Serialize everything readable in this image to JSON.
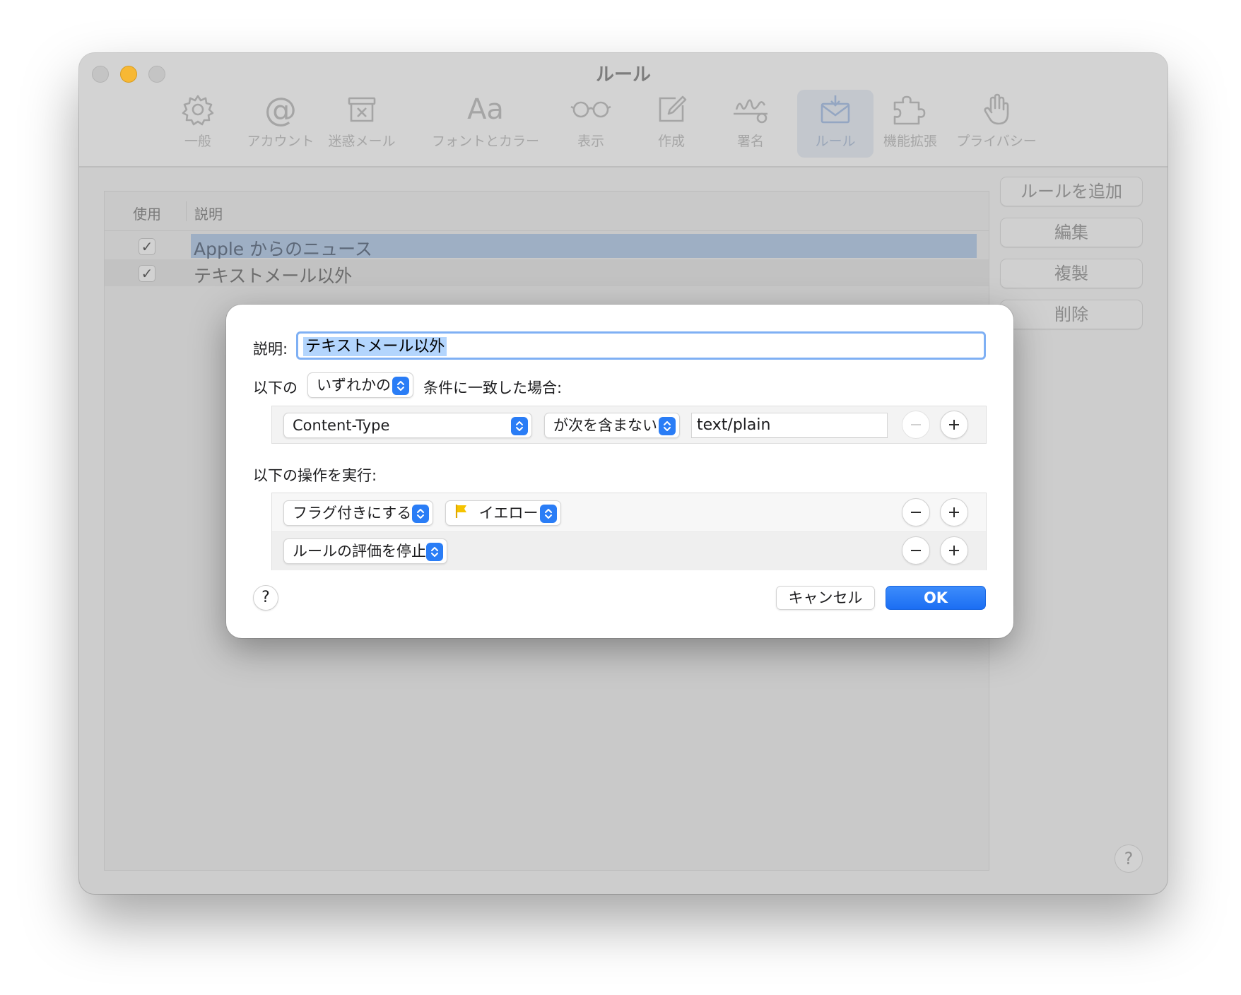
{
  "window": {
    "title": "ルール"
  },
  "toolbar": {
    "tabs": [
      {
        "label": "一般",
        "icon": "gear-icon"
      },
      {
        "label": "アカウント",
        "icon": "at-sign-icon"
      },
      {
        "label": "迷惑メール",
        "icon": "junk-tray-icon"
      },
      {
        "label": "フォントとカラー",
        "icon": "font-icon"
      },
      {
        "label": "表示",
        "icon": "glasses-icon"
      },
      {
        "label": "作成",
        "icon": "compose-icon"
      },
      {
        "label": "署名",
        "icon": "signature-icon"
      },
      {
        "label": "ルール",
        "icon": "rules-envelope-icon"
      },
      {
        "label": "機能拡張",
        "icon": "puzzle-icon"
      },
      {
        "label": "プライバシー",
        "icon": "hand-icon"
      }
    ],
    "active": "ルール",
    "glyphs": {
      "at": "@",
      "font": "Aa"
    }
  },
  "rules_list": {
    "header": {
      "use": "使用",
      "description": "説明"
    },
    "rows": [
      {
        "enabled": true,
        "check": "✓",
        "description": "Apple からのニュース",
        "selected": true
      },
      {
        "enabled": true,
        "check": "✓",
        "description": "テキストメール以外",
        "selected": false
      }
    ]
  },
  "side_buttons": {
    "add_rule": "ルールを追加",
    "edit": "編集",
    "duplicate": "複製",
    "delete": "削除"
  },
  "window_help": "?",
  "dialog": {
    "description_label": "説明:",
    "description_value": "テキストメール以外",
    "condition_prefix": "以下の",
    "match_mode": "いずれかの",
    "condition_suffix": "条件に一致した場合:",
    "condition": {
      "field": "Content-Type",
      "operator": "が次を含まない",
      "value": "text/plain",
      "remove": "−",
      "add": "+"
    },
    "actions_label": "以下の操作を実行:",
    "actions": [
      {
        "action": "フラグ付きにする",
        "option": "イエロー",
        "option_color": "#f5c300"
      },
      {
        "action": "ルールの評価を停止"
      }
    ],
    "help": "?",
    "cancel": "キャンセル",
    "ok": "OK"
  },
  "colors": {
    "accent": "#2a7df6",
    "selection_text": "#b3d5fd",
    "focus_ring": "#7fb0f4",
    "minimize": "#f7b834"
  }
}
